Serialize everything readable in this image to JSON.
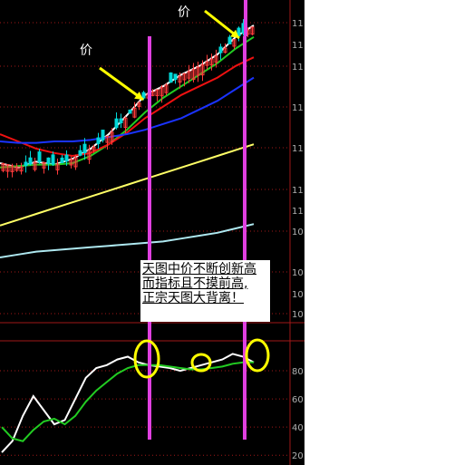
{
  "colors": {
    "background": "#000000",
    "candle_up": "#ff3b3b",
    "candle_down": "#00d8d8",
    "ma_white": "#ffffff",
    "ma_green": "#22cc22",
    "ma_red": "#ee1111",
    "ma_blue": "#1a33ff",
    "ma_yellow": "#ffff66",
    "ma_cyan": "#aee8f0",
    "grid": "#a01818",
    "marker_magenta": "#e040e0",
    "marker_yellow": "#ffff00"
  },
  "annotations": {
    "price_label_1": "价",
    "price_label_2": "价",
    "note_lines": [
      "天图中价不断创新高",
      "而指标且不摸前高,",
      "正宗天图大背离！"
    ]
  },
  "chart_data": [
    {
      "type": "line",
      "panel": "price",
      "y_tick_labels": [
        "11",
        "11",
        "11",
        "11",
        "11",
        "11",
        "11",
        "10",
        "10",
        "10",
        "10"
      ],
      "legend": "none",
      "grid": "dotted-horizontal",
      "series": [
        {
          "color": "#ffffff",
          "values": [
            11.05,
            11.02,
            11.06,
            11.04,
            11.08,
            11.15,
            11.25,
            11.38,
            11.52,
            11.58,
            11.66,
            11.72,
            11.8,
            11.92,
            12.0
          ]
        },
        {
          "color": "#22cc22",
          "values": [
            11.02,
            11.03,
            11.04,
            11.04,
            11.05,
            11.1,
            11.18,
            11.28,
            11.4,
            11.5,
            11.58,
            11.66,
            11.74,
            11.84,
            11.92
          ]
        },
        {
          "color": "#ee1111",
          "values": [
            11.25,
            11.2,
            11.15,
            11.12,
            11.1,
            11.12,
            11.18,
            11.26,
            11.36,
            11.44,
            11.52,
            11.58,
            11.64,
            11.72,
            11.78
          ]
        },
        {
          "color": "#1a33ff",
          "values": [
            11.2,
            11.19,
            11.19,
            11.2,
            11.2,
            11.21,
            11.23,
            11.25,
            11.28,
            11.32,
            11.36,
            11.42,
            11.48,
            11.56,
            11.64
          ]
        },
        {
          "color": "#ffff66",
          "values": [
            10.62,
            10.66,
            10.7,
            10.74,
            10.78,
            10.82,
            10.86,
            10.9,
            10.94,
            10.98,
            11.02,
            11.06,
            11.1,
            11.14,
            11.18
          ]
        },
        {
          "color": "#aee8f0",
          "values": [
            10.4,
            10.42,
            10.44,
            10.45,
            10.46,
            10.47,
            10.48,
            10.49,
            10.5,
            10.51,
            10.53,
            10.55,
            10.57,
            10.6,
            10.63
          ]
        }
      ]
    },
    {
      "type": "line",
      "panel": "indicator",
      "y_tick_labels": [
        "80",
        "60",
        "40",
        "20"
      ],
      "ylim": [
        15,
        100
      ],
      "legend": "none",
      "grid": "dotted-horizontal",
      "x": [
        0,
        1,
        2,
        3,
        4,
        5,
        6,
        7,
        8,
        9,
        10,
        11,
        12,
        13,
        14,
        15,
        16,
        17,
        18,
        19,
        20,
        21,
        22,
        23,
        24
      ],
      "series": [
        {
          "color": "#ffffff",
          "values": [
            22,
            30,
            48,
            62,
            52,
            42,
            45,
            60,
            75,
            82,
            84,
            88,
            90,
            86,
            84,
            83,
            82,
            80,
            82,
            84,
            86,
            88,
            92,
            90,
            86
          ]
        },
        {
          "color": "#22cc22",
          "values": [
            40,
            32,
            30,
            38,
            44,
            46,
            42,
            48,
            58,
            66,
            72,
            78,
            82,
            84,
            84,
            84,
            83,
            82,
            81,
            81,
            82,
            83,
            85,
            86,
            86
          ]
        }
      ]
    }
  ]
}
